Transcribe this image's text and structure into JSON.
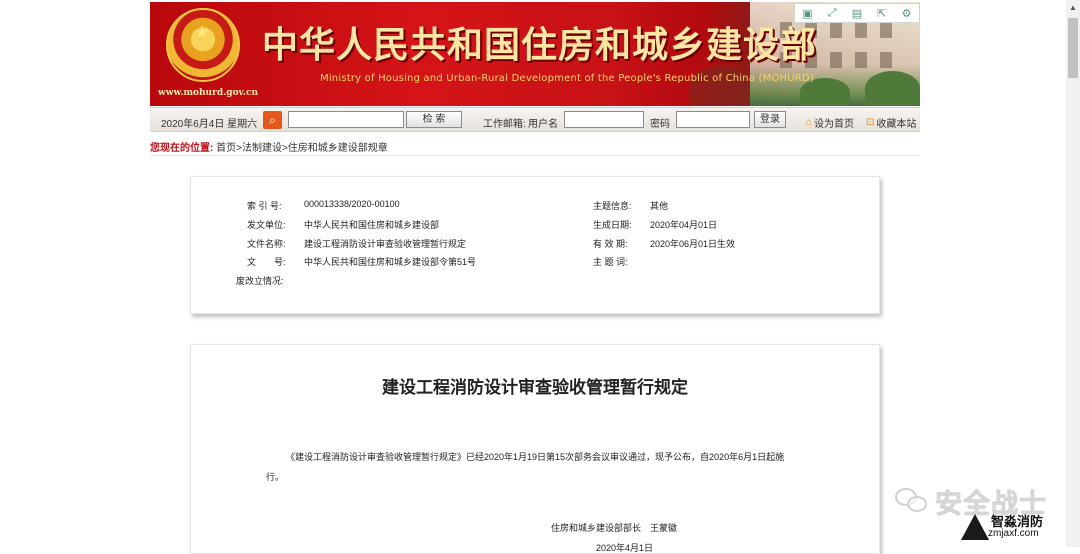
{
  "banner": {
    "title": "中华人民共和国住房和城乡建设部",
    "english": "Ministry of Housing and Urban-Rural Development of the People's Republic of China (MOHURD)",
    "url": "www.mohurd.gov.cn",
    "tool_icons": [
      "bookmark-icon",
      "fullscreen-icon",
      "save-icon",
      "share-icon",
      "settings-icon"
    ]
  },
  "toolbar": {
    "date": "2020年6月4日 星期六",
    "search_button": "检 索",
    "mail_label": "工作邮箱:",
    "username_label": "用户名",
    "password_label": "密码",
    "login_button": "登录",
    "set_home": "设为首页",
    "bookmark": "收藏本站"
  },
  "breadcrumb": {
    "here": "您现在的位置:",
    "path": "首页>法制建设>住房和城乡建设部规章"
  },
  "info": {
    "index_label": "索 引 号:",
    "index_value": "000013338/2020-00100",
    "issuer_label": "发文单位:",
    "issuer_value": "中华人民共和国住房和城乡建设部",
    "filename_label": "文件名称:",
    "filename_value": "建设工程消防设计审查验收管理暂行规定",
    "docno_label": "文　　号:",
    "docno_value": "中华人民共和国住房和城乡建设部令第51号",
    "revise_label": "废改立情况:",
    "topic_label": "主题信息:",
    "topic_value": "其他",
    "created_label": "生成日期:",
    "created_value": "2020年04月01日",
    "valid_label": "有 效 期:",
    "valid_value": "2020年06月01日生效",
    "keywords_label": "主 题 词:"
  },
  "document": {
    "title": "建设工程消防设计审查验收管理暂行规定",
    "para1": "《建设工程消防设计审查验收管理暂行规定》已经2020年1月19日第15次部务会议审议通过，现予公布，自2020年6月1日起施",
    "para2": "行。",
    "signature": "住房和城乡建设部部长　王蒙徽",
    "date": "2020年4月1日"
  },
  "watermark": {
    "big": "安全战士",
    "cn": "智淼消防",
    "site": "zmjaxf.com"
  }
}
